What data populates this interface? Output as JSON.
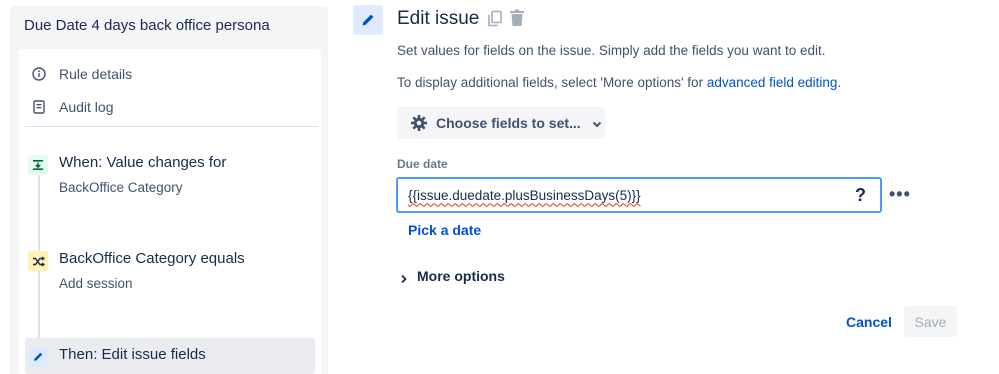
{
  "rule": {
    "title": "Due Date 4 days back office persona",
    "menu": [
      {
        "label": "Rule details",
        "icon": "info-icon"
      },
      {
        "label": "Audit log",
        "icon": "document-icon"
      }
    ],
    "steps": [
      {
        "title": "When: Value changes for",
        "subtitle": "BackOffice Category",
        "icon": "trigger-icon",
        "icon_bg": "#e3fcef",
        "icon_color": "#006644"
      },
      {
        "title": "BackOffice Category equals",
        "subtitle": "Add session",
        "icon": "shuffle-icon",
        "icon_bg": "#fff0b3",
        "icon_color": "#172b4d"
      },
      {
        "title": "Then: Edit issue fields",
        "icon": "pencil-icon",
        "icon_bg": "#deebff",
        "icon_color": "#0052cc"
      }
    ]
  },
  "edit": {
    "title": "Edit issue",
    "desc1": "Set values for fields on the issue. Simply add the fields you want to edit.",
    "desc2_prefix": "To display additional fields, select 'More options' for ",
    "desc2_link": "advanced field editing",
    "desc2_suffix": ".",
    "choose_label": "Choose fields to set...",
    "field_label": "Due date",
    "field_value": "{{issue.duedate.plusBusinessDays(5)}}",
    "help_label": "?",
    "more_label": "•••",
    "pick_date_label": "Pick a date",
    "more_options_label": "More options",
    "cancel_label": "Cancel",
    "save_label": "Save"
  },
  "colors": {
    "accent": "#0052cc",
    "focus_border": "#4c9aff",
    "panel_bg": "#f4f5f7"
  }
}
